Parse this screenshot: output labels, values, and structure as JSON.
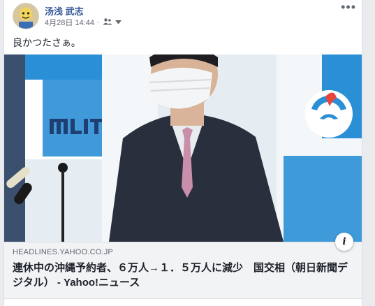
{
  "post": {
    "author": "汤浅 武志",
    "date": "4月28日 14:44",
    "separator": "·",
    "privacy_icon": "friends-icon",
    "dropdown_icon": "caret-down-icon",
    "more_label": "•••",
    "text": "良かつたさぁ。"
  },
  "photo": {
    "logo_text": "MLIT"
  },
  "link": {
    "domain": "HEADLINES.YAHOO.CO.JP",
    "title": "連休中の沖縄予約者、６万人→１．５万人に減少　国交相（朝日新聞デジタル） - Yahoo!ニュース",
    "info_label": "i"
  },
  "colors": {
    "author": "#365899",
    "background": "#e9ebee",
    "link_box": "#f2f3f5",
    "mlit_blue": "#2b8fd6"
  }
}
